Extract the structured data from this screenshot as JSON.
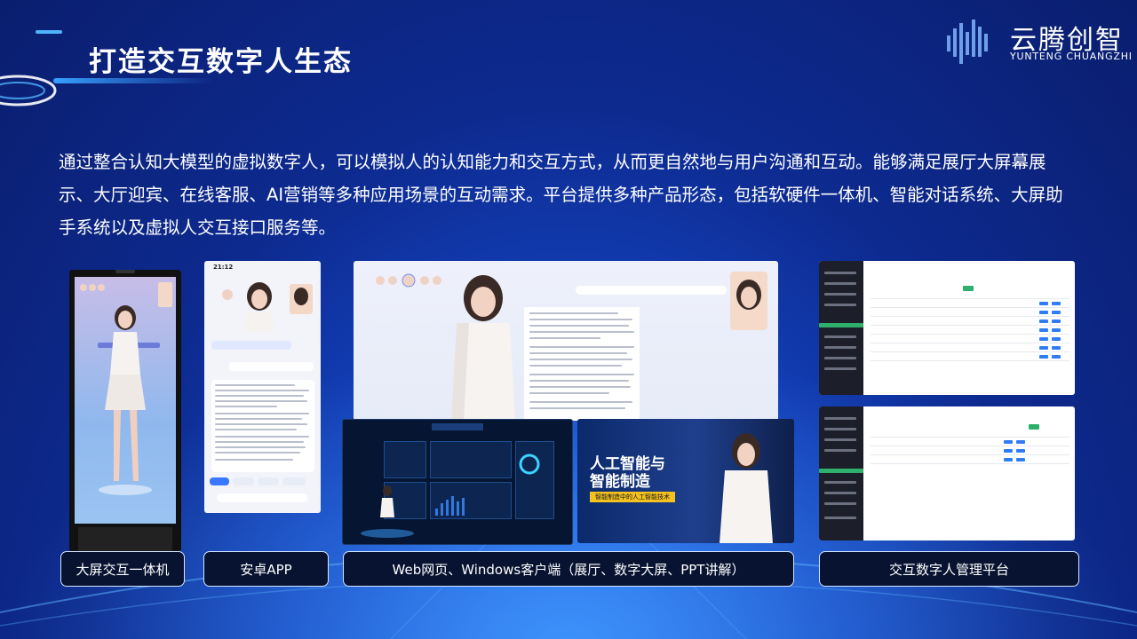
{
  "header": {
    "title": "打造交互数字人生态",
    "logo_cn": "云腾创智",
    "logo_en": "YUNTENG CHUANGZHI"
  },
  "intro": "通过整合认知大模型的虚拟数字人，可以模拟人的认知能力和交互方式，从而更自然地与用户沟通和互动。能够满足展厅大屏幕展示、大厅迎宾、在线客服、AI营销等多种应用场景的互动需求。平台提供多种产品形态，包括软硬件一体机、智能对话系统、大屏助手系统以及虚拟人交互接口服务等。",
  "products": [
    {
      "label": "大屏交互一体机"
    },
    {
      "label": "安卓APP"
    },
    {
      "label": "Web网页、Windows客户端（展厅、数字大屏、PPT讲解）"
    },
    {
      "label": "交互数字人管理平台"
    }
  ],
  "phone": {
    "time": "21:12"
  },
  "ppt": {
    "title_line1": "人工智能与",
    "title_line2": "智能制造",
    "tag": "智能制造中的人工智能技术"
  },
  "colors": {
    "accent": "#4fb4ff",
    "bg_dark": "#0a1e6e",
    "bg_light": "#2a7bff",
    "label_border": "#d4e6ff"
  }
}
